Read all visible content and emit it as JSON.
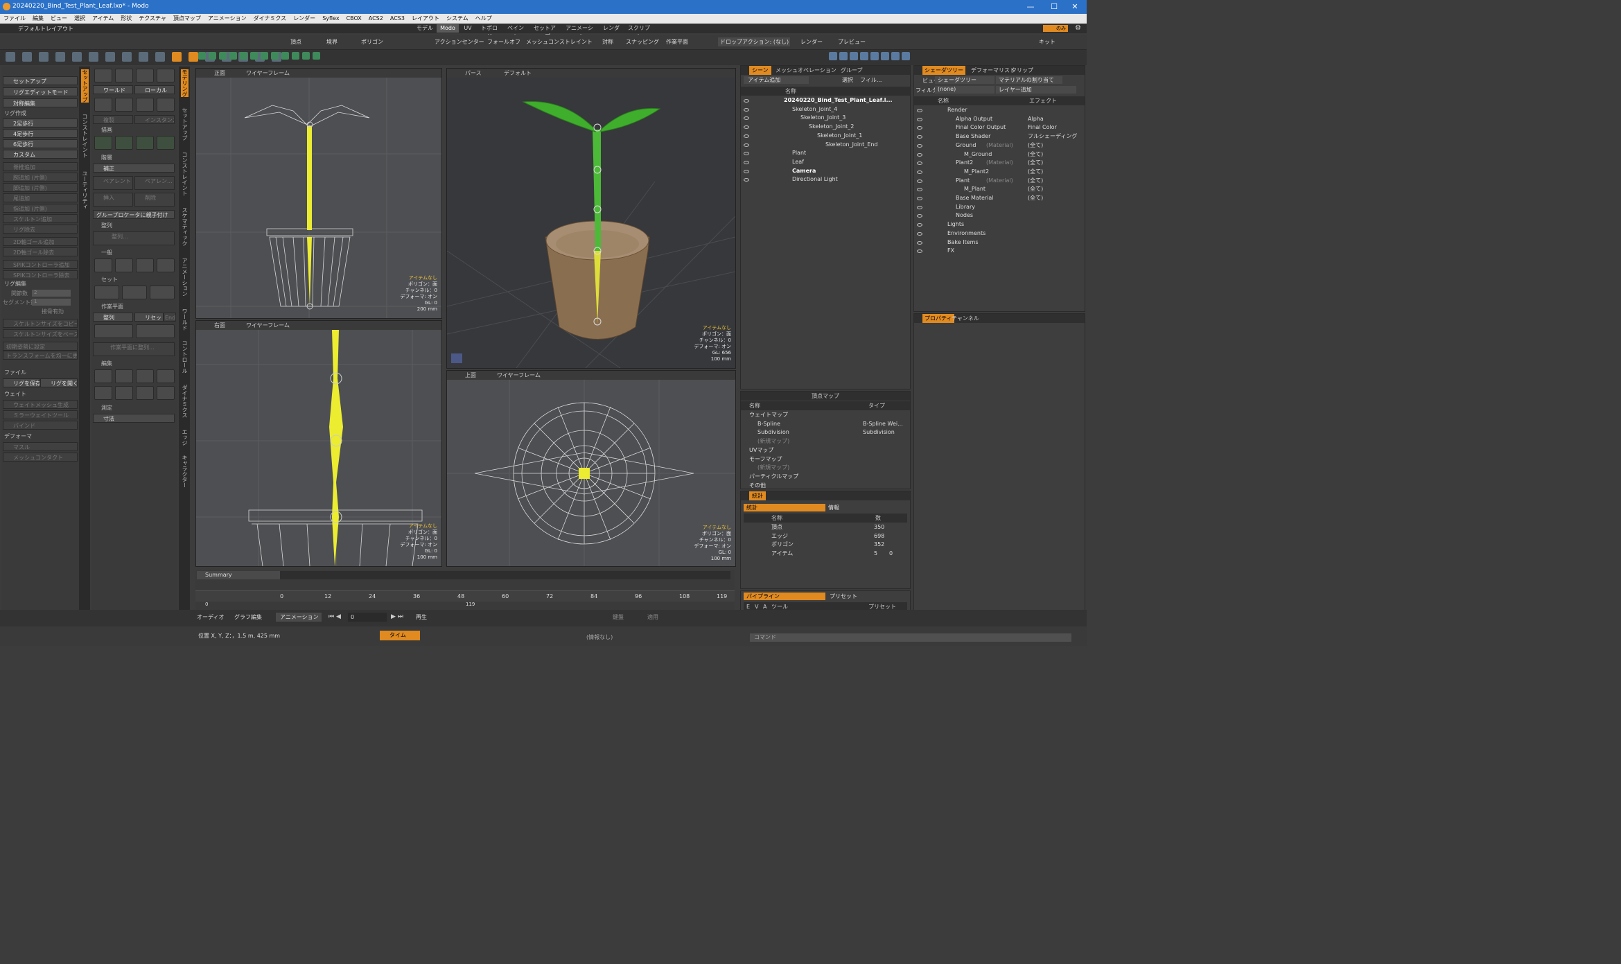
{
  "window": {
    "title": "20240220_Bind_Test_Plant_Leaf.lxo* - Modo",
    "controls": [
      "—",
      "☐",
      "✕"
    ]
  },
  "menu": [
    "ファイル",
    "編集",
    "ビュー",
    "選択",
    "アイテム",
    "形状",
    "テクスチャ",
    "頂点マップ",
    "アニメーション",
    "ダイナミクス",
    "レンダー",
    "Syflex",
    "CBOX",
    "ACS2",
    "ACS3",
    "レイアウト",
    "システム",
    "ヘルプ"
  ],
  "layout": {
    "name": "デフォルトレイアウト",
    "tabs": [
      "モデル",
      "Modo",
      "UV",
      "トポロジ",
      "ペイント",
      "セットアップ",
      "アニメーション",
      "レンダー",
      "スクリプト"
    ],
    "active": "Modo",
    "only": "のみ"
  },
  "toolbar": {
    "items": [
      "頂点",
      "境界",
      "ポリゴン",
      "アクションセンター",
      "フォールオフ",
      "メッシュコンストレイント",
      "対称",
      "スナッピング",
      "作業平面",
      "ドロップアクション: (なし)",
      "レンダー",
      "プレビュー",
      "キット"
    ]
  },
  "left_tabs": [
    "セットアップ",
    "コンストレイント",
    "ユーティリティ"
  ],
  "left_tabs2": [
    "モデリング",
    "セットアップ",
    "コンストレイント",
    "スケマティック",
    "アニメーション",
    "ワールド",
    "コントロール",
    "ダイナミクス",
    "エッジ",
    "キャラクター"
  ],
  "rig": {
    "top": [
      "セットアップ",
      "リグエディットモード",
      "対称編集"
    ],
    "create_hdr": "リグ作成",
    "create": [
      "2足歩行",
      "4足歩行",
      "6足歩行",
      "カスタム"
    ],
    "edit_items": [
      "脊椎追加",
      "腕追加 (片側)",
      "脚追加 (片側)",
      "尾追加",
      "指追加 (片側)",
      "スケルトン追加",
      "リグ除去",
      "2D軸ゴール追加",
      "2D軸ゴール除去",
      "SPIKコントローラ追加",
      "SPIKコントローラ除去"
    ],
    "edit_hdr": "リグ編集",
    "joint_lbl": "関節数",
    "joint_val": "2",
    "seg_lbl": "セグメント数",
    "seg_val": "1",
    "bone": "接骨有効",
    "copy": "スケルトンサイズをコピー",
    "paste": "スケルトンサイズをペースト",
    "init": "初期姿勢に設定",
    "xform": "トランスフォームを均一に更新",
    "file_hdr": "ファイル",
    "save": "リグを保存",
    "open": "リグを開く",
    "weight_hdr": "ウェイト",
    "weight": [
      "ウェイトメッシュ生成",
      "ミラーウェイトツール",
      "バインド"
    ],
    "deform_hdr": "デフォーマ",
    "deform": [
      "マスル",
      "メッシュコンタクト"
    ]
  },
  "tools": {
    "world": "ワールド",
    "local": "ローカル",
    "duplicate": "複製",
    "instance": "インスタンス",
    "draw_hdr": "描画",
    "hier_hdr": "階層",
    "correct": "補正",
    "parent": "ペアレント",
    "unparent": "ペアレン...",
    "insert": "挿入",
    "delete": "削除",
    "group_parent": "グループロケータに親子付け",
    "align_hdr": "整列",
    "align": "整列...",
    "general_hdr": "一般",
    "set_hdr": "セット",
    "wp_hdr": "作業平面",
    "wp_align": "整列",
    "wp_reset": "リセット",
    "wp_end": "End",
    "wp_alignto": "作業平面に整列...",
    "edit_hdr": "編集",
    "measure_hdr": "測定",
    "dimension": "寸法"
  },
  "viewports": {
    "front": {
      "name": "正面",
      "mode": "ワイヤーフレーム",
      "info": [
        "アイテムなし",
        "ポリゴン：面",
        "チャンネル：0",
        "デフォーマ: オン",
        "GL: 0",
        "200 mm"
      ]
    },
    "persp": {
      "name": "パース",
      "mode": "デフォルト",
      "info": [
        "アイテムなし",
        "ポリゴン：面",
        "チャンネル：0",
        "デフォーマ: オン",
        "GL: 656",
        "100 mm"
      ]
    },
    "right": {
      "name": "右面",
      "mode": "ワイヤーフレーム",
      "info": [
        "アイテムなし",
        "ポリゴン：面",
        "チャンネル：0",
        "デフォーマ: オン",
        "GL: 0",
        "100 mm"
      ]
    },
    "top": {
      "name": "上面",
      "mode": "ワイヤーフレーム",
      "info": [
        "アイテムなし",
        "ポリゴン：面",
        "チャンネル：0",
        "デフォーマ: オン",
        "GL: 0",
        "100 mm"
      ]
    }
  },
  "scene": {
    "tabs": [
      "シーン",
      "メッシュオペレーション",
      "グループ"
    ],
    "add": "アイテム追加",
    "select": "選択",
    "filter": "フィル...",
    "col": "名称",
    "items": [
      {
        "label": "20240220_Bind_Test_Plant_Leaf.l...",
        "d": 0,
        "bold": true
      },
      {
        "label": "Skeleton_Joint_4",
        "d": 1
      },
      {
        "label": "Skeleton_Joint_3",
        "d": 2
      },
      {
        "label": "Skeleton_Joint_2",
        "d": 3
      },
      {
        "label": "Skeleton_Joint_1",
        "d": 4
      },
      {
        "label": "Skeleton_Joint_End",
        "d": 5
      },
      {
        "label": "Plant",
        "d": 1
      },
      {
        "label": "Leaf",
        "d": 1
      },
      {
        "label": "Camera",
        "d": 1,
        "bold": true
      },
      {
        "label": "Directional Light",
        "d": 1
      }
    ]
  },
  "vmap": {
    "title": "頂点マップ",
    "cols": [
      "名称",
      "タイプ"
    ],
    "rows": [
      [
        "ウェイトマップ",
        ""
      ],
      [
        "B-Spline",
        "B-Spline Wei..."
      ],
      [
        "Subdivision",
        "Subdivision"
      ],
      [
        "(新規マップ)",
        ""
      ],
      [
        "UVマップ",
        ""
      ],
      [
        "モーフマップ",
        ""
      ],
      [
        "(新規マップ)",
        ""
      ],
      [
        "パーティクルマップ",
        ""
      ],
      [
        "その他",
        ""
      ]
    ]
  },
  "stats": {
    "tab": "統計",
    "tabs": [
      "統計",
      "情報"
    ],
    "cols": [
      "名称",
      "数"
    ],
    "rows": [
      [
        "頂点",
        "350"
      ],
      [
        "エッジ",
        "698"
      ],
      [
        "ポリゴン",
        "352"
      ],
      [
        "アイテム",
        "5",
        "0"
      ]
    ]
  },
  "pipeline": {
    "tabs": [
      "パイプライン",
      "プリセット"
    ],
    "cols": [
      "E",
      "V",
      "A",
      "ツール",
      "プリセット"
    ]
  },
  "shader": {
    "tabs": [
      "シェーダツリー",
      "デフォーマリスト",
      "クリップ"
    ],
    "view_lbl": "ビュー",
    "view": "シェーダツリー",
    "assign": "マテリアルの割り当て",
    "filter_lbl": "フィルター",
    "filter": "(none)",
    "layer": "レイヤー追加",
    "cols": [
      "名称",
      "エフェクト"
    ],
    "rows": [
      {
        "n": "Render",
        "e": "",
        "d": 0
      },
      {
        "n": "Alpha Output",
        "e": "Alpha",
        "d": 1
      },
      {
        "n": "Final Color Output",
        "e": "Final Color",
        "d": 1
      },
      {
        "n": "Base Shader",
        "e": "フルシェーディング",
        "d": 1
      },
      {
        "n": "Ground",
        "m": "(Material)",
        "e": "(全て)",
        "d": 1
      },
      {
        "n": "M_Ground",
        "e": "(全て)",
        "d": 2
      },
      {
        "n": "Plant2",
        "m": "(Material)",
        "e": "(全て)",
        "d": 1
      },
      {
        "n": "M_Plant2",
        "e": "(全て)",
        "d": 2
      },
      {
        "n": "Plant",
        "m": "(Material)",
        "e": "(全て)",
        "d": 1
      },
      {
        "n": "M_Plant",
        "e": "(全て)",
        "d": 2
      },
      {
        "n": "Base Material",
        "e": "(全て)",
        "d": 1
      },
      {
        "n": "Library",
        "e": "",
        "d": 1
      },
      {
        "n": "Nodes",
        "e": "",
        "d": 1
      },
      {
        "n": "Lights",
        "e": "",
        "d": 0
      },
      {
        "n": "Environments",
        "e": "",
        "d": 0
      },
      {
        "n": "Bake Items",
        "e": "",
        "d": 0
      },
      {
        "n": "FX",
        "e": "",
        "d": 0
      }
    ]
  },
  "props": {
    "tabs": [
      "プロパティ",
      "チャンネル"
    ]
  },
  "timeline": {
    "summary": "Summary",
    "ticks": [
      "0",
      "12",
      "24",
      "36",
      "48",
      "60",
      "72",
      "84",
      "96",
      "108"
    ],
    "end": "119",
    "start_lbl": "0",
    "end_lbl": "119"
  },
  "playbar": {
    "audio": "オーディオ",
    "graph": "グラフ編集",
    "anim": "アニメーション",
    "frame": "0",
    "play": "再生",
    "key": "鍵盤",
    "apply": "適用"
  },
  "status": {
    "pos": "位置 X, Y, Z：，1.5 m, 425 mm",
    "time": "タイム",
    "info": "(情報なし)",
    "command": "コマンド"
  }
}
